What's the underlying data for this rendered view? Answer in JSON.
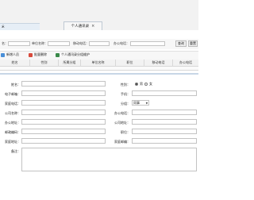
{
  "tabs": {
    "first_label": "ӝ",
    "active_label": "个人通讯录",
    "close_glyph": "×"
  },
  "search": {
    "field1_label": "名：",
    "field2_label": "单位名称：",
    "field3_label": "移动电话：",
    "field4_label": "办公电话：",
    "search_button": "查询",
    "reset_button": "重置"
  },
  "toolbar": {
    "add_label": "新增人员",
    "delete_label": "批量删除",
    "contacts_label": "个人通讯录分组维护",
    "add_icon_color": "#4a8fd8",
    "delete_icon_color": "#d84a3c",
    "contacts_icon_color": "#3a8a4a"
  },
  "grid": {
    "columns": [
      "姓名",
      "性别",
      "所属分组",
      "单位名称",
      "职位",
      "移动电话",
      "办公电话"
    ]
  },
  "form": {
    "name_label": "姓名：",
    "gender_label": "性别：",
    "gender_male": "男",
    "gender_female": "女",
    "email_label": "电子邮箱：",
    "mobile_label": "手机：",
    "home_phone_label": "家庭电话：",
    "group_label": "分组：",
    "group_value": "同事",
    "company_label": "公司名称：",
    "office_phone_label": "办公电话：",
    "office_addr_label": "办公地址：",
    "company_addr_label": "公司地址：",
    "postcode_label": "邮政编码：",
    "position_label": "职位：",
    "home_addr_label": "家庭地址：",
    "home_postcode_label": "家庭邮编：",
    "remark_label": "备注："
  }
}
